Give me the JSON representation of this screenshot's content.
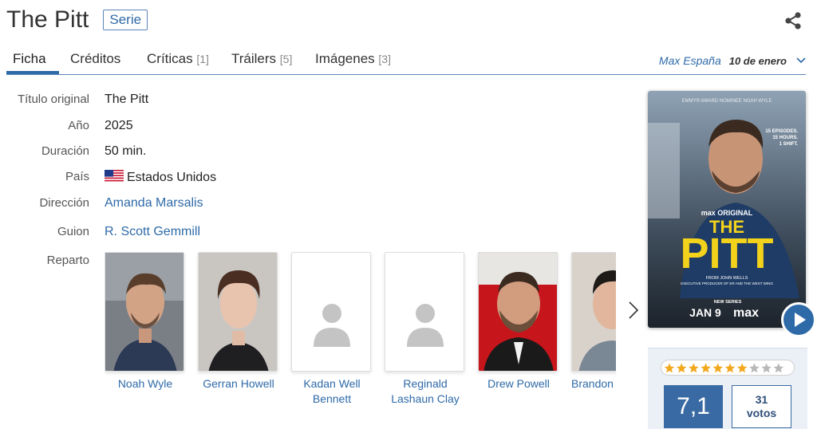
{
  "header": {
    "title": "The Pitt",
    "type_badge": "Serie"
  },
  "tabs": [
    {
      "label": "Ficha",
      "count": ""
    },
    {
      "label": "Créditos",
      "count": ""
    },
    {
      "label": "Críticas",
      "count": "[1]"
    },
    {
      "label": "Tráilers",
      "count": "[5]"
    },
    {
      "label": "Imágenes",
      "count": "[3]"
    }
  ],
  "release": {
    "platform": "Max España",
    "date": "10 de enero"
  },
  "info": [
    {
      "label": "Título original",
      "value": "The Pitt"
    },
    {
      "label": "Año",
      "value": "2025"
    },
    {
      "label": "Duración",
      "value": "50 min."
    },
    {
      "label": "País",
      "value": "Estados Unidos"
    },
    {
      "label": "Dirección",
      "value": "Amanda Marsalis"
    },
    {
      "label": "Guion",
      "value": "R. Scott Gemmill"
    },
    {
      "label": "Reparto",
      "value": ""
    }
  ],
  "cast": [
    {
      "name": "Noah Wyle",
      "has_photo": true
    },
    {
      "name": "Gerran Howell",
      "has_photo": true
    },
    {
      "name": "Kadan Well Bennett",
      "has_photo": false
    },
    {
      "name": "Reginald Lashaun Clay",
      "has_photo": false
    },
    {
      "name": "Drew Powell",
      "has_photo": true
    },
    {
      "name": "Brandon Keener",
      "has_photo": true
    }
  ],
  "poster": {
    "top_text": "EMMY® AWARD NOMINEE NOAH WYLE",
    "side_text": [
      "15 EPISODES.",
      "15 HOURS.",
      "1 SHIFT."
    ],
    "brand": "max ORIGINAL",
    "title_line1": "THE",
    "title_line2": "PITT",
    "credit_line1": "FROM JOHN WELLS",
    "credit_line2": "EXECUTIVE PRODUCER OF ER AND THE WEST WING",
    "new_series": "NEW SERIES",
    "date": "JAN 9",
    "network": "max"
  },
  "rating": {
    "value": "7,1",
    "votes": "31",
    "votes_label": "votos",
    "stars_filled": 7,
    "stars_total": 10
  },
  "colors": {
    "accent": "#2e6aa8",
    "rating_bg": "#3a6aa3",
    "poster_yellow": "#f3d21b"
  }
}
